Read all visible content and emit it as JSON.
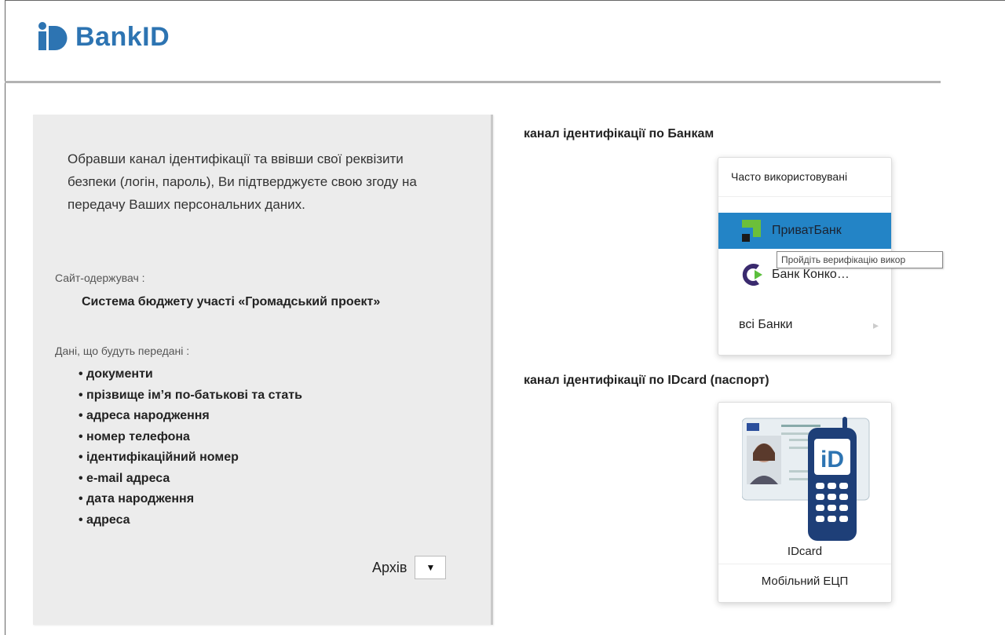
{
  "header": {
    "logo_text": "BankID",
    "brand_color": "#2d74b2"
  },
  "left": {
    "intro": "Обравши канал ідентифікації та ввівши свої реквізити безпеки (логін, пароль), Ви підтверджуєте свою згоду на передачу Ваших персональних даних.",
    "recipient_label": "Сайт-одержувач :",
    "recipient_name": "Система бюджету участі «Громадський проект»",
    "data_label": "Дані, що будуть передані :",
    "data_items": [
      "документи",
      "прізвище ім’я по-батькові та стать",
      "адреса народження",
      "номер телефона",
      "ідентифікаційний номер",
      "e-mail адреса",
      "дата народження",
      "адреса"
    ],
    "archive_label": "Архів",
    "archive_button": "▼"
  },
  "banks": {
    "title": "канал ідентифікації по Банкам",
    "header": "Часто використовувані",
    "items": [
      {
        "label": "ПриватБанк",
        "icon": "privatbank-icon",
        "active": true
      },
      {
        "label": "Банк Конко…",
        "icon": "concord-bank-icon",
        "active": false
      }
    ],
    "all_label": "всі Банки",
    "tooltip": "Пройдіть верифікацію викор",
    "active_color": "#2384c6"
  },
  "idcard": {
    "title": "канал ідентифікації по IDcard (паспорт)",
    "name": "IDcard",
    "mobile": "Мобільний ЕЦП",
    "illustration": "idcard-phone-illustration"
  }
}
